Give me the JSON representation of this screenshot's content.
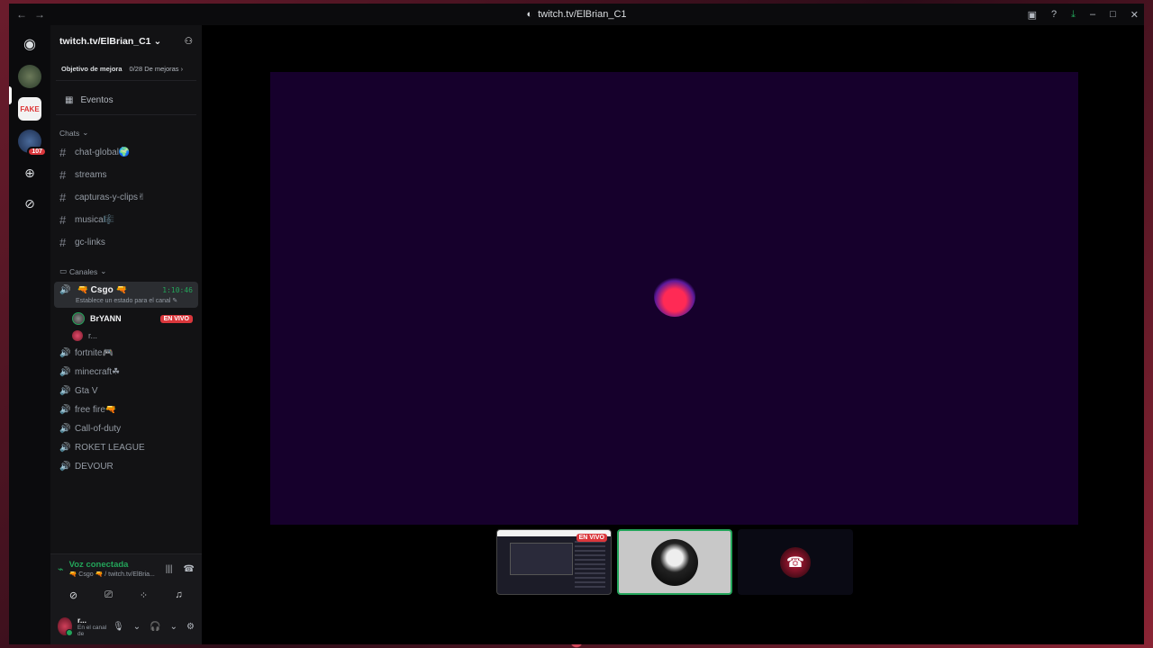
{
  "titlebar": {
    "back": "←",
    "forward": "→",
    "title": "twitch.tv/ElBrian_C1"
  },
  "server": {
    "name": "twitch.tv/ElBrian_C1",
    "boost_label": "Objetivo de mejora",
    "boost_progress": "0/28 De mejoras",
    "events_label": "Eventos"
  },
  "rail": {
    "badge_count": "107"
  },
  "categories": {
    "chats": "Chats",
    "canales": "Canales"
  },
  "text_channels": [
    {
      "name": "chat-global🌍"
    },
    {
      "name": "streams"
    },
    {
      "name": "capturas-y-clips✌"
    },
    {
      "name": "musica🎼"
    },
    {
      "name": "gc-links"
    }
  ],
  "active_voice": {
    "name": "🔫 Csgo 🔫",
    "time": "1:10:46",
    "status": "Establece un estado para el canal",
    "members": [
      {
        "name": "BrYANN",
        "live": "EN VIVO"
      },
      {
        "name": "r..."
      }
    ]
  },
  "voice_channels": [
    {
      "name": "fortnite🎮"
    },
    {
      "name": "minecraft☘"
    },
    {
      "name": "Gta V"
    },
    {
      "name": "free fire🔫"
    },
    {
      "name": "Call-of-duty"
    },
    {
      "name": "ROKET LEAGUE"
    },
    {
      "name": "DEVOUR"
    }
  ],
  "voice_panel": {
    "status": "Voz conectada",
    "channel": "🔫 Csgo 🔫 / twitch.tv/ElBria..."
  },
  "user": {
    "name": "r...",
    "sub": "En el canal de"
  },
  "thumbnails": {
    "live_label": "EN VIVO"
  },
  "colors": {
    "accent_green": "#23a55a",
    "live_red": "#da373c",
    "video_bg": "#16002c"
  }
}
